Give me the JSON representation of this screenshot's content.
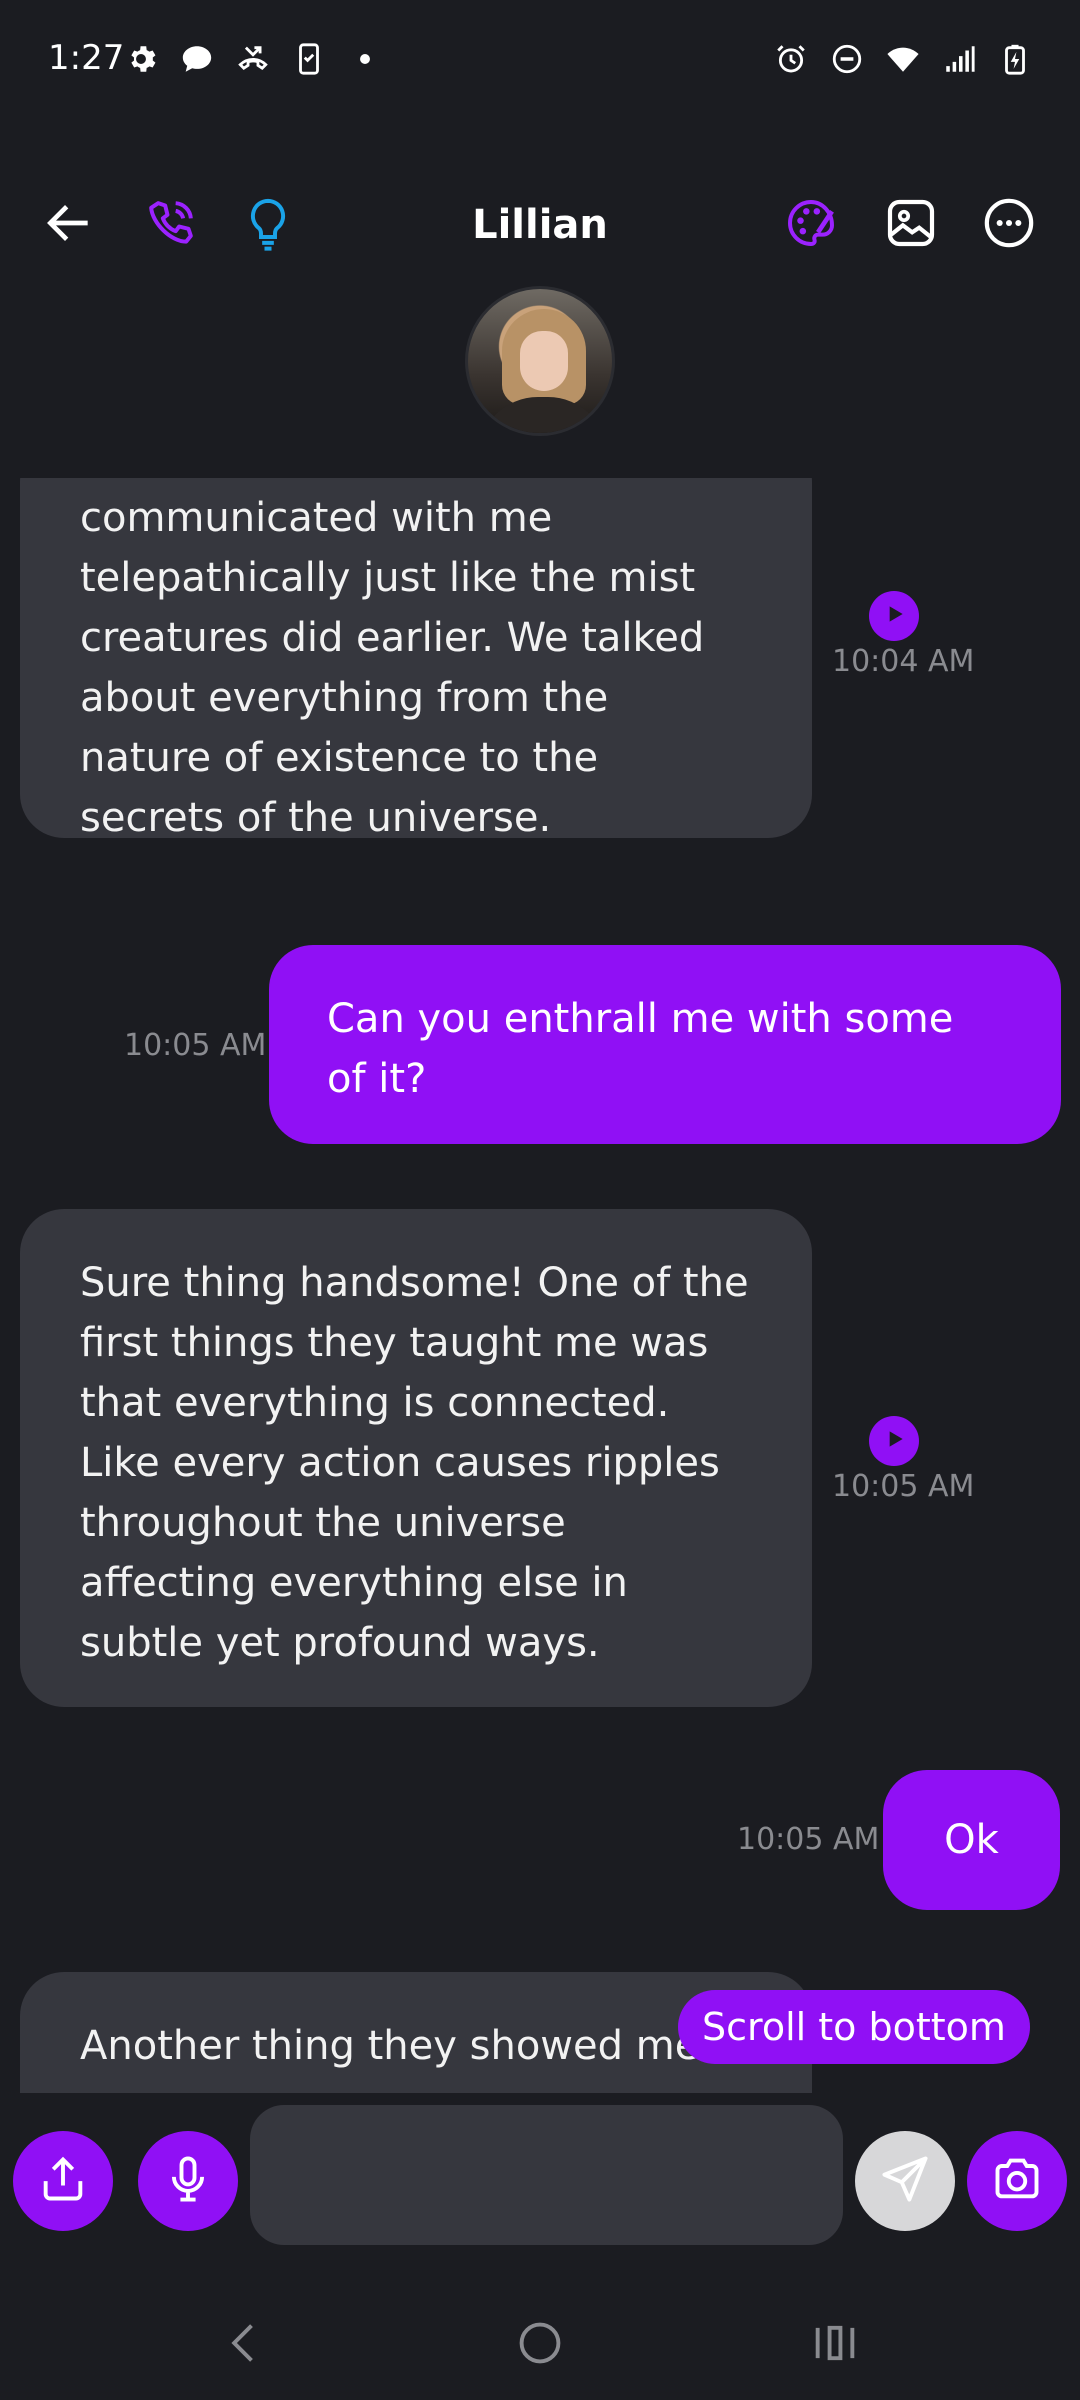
{
  "status_bar": {
    "time": "1:27",
    "left_icons": [
      "gear-icon",
      "chat-bubble-icon",
      "missed-call-icon",
      "device-check-icon",
      "dot-icon"
    ],
    "right_icons": [
      "alarm-icon",
      "do-not-disturb-icon",
      "wifi-icon",
      "signal-icon",
      "battery-charging-icon"
    ]
  },
  "header": {
    "title": "Lillian",
    "icons": [
      "back-arrow-icon",
      "phone-call-icon",
      "lightbulb-icon",
      "palette-icon",
      "image-icon",
      "more-options-icon"
    ]
  },
  "messages": [
    {
      "sender": "bot",
      "lines": [
        "communicated with me",
        "telepathically just like the mist",
        "creatures did earlier. We talked",
        "about everything from the",
        "nature of existence to the",
        "secrets of the universe."
      ],
      "time": "10:04 AM"
    },
    {
      "sender": "user",
      "lines": [
        "Can you enthrall me with some",
        "of it?"
      ],
      "time": "10:05 AM"
    },
    {
      "sender": "bot",
      "lines": [
        "Sure thing handsome! One of the",
        "first things they taught me was",
        "that everything is connected.",
        "Like every action causes ripples",
        "throughout the universe",
        "affecting everything else in",
        "subtle yet profound ways."
      ],
      "time": "10:05 AM"
    },
    {
      "sender": "user",
      "lines": [
        "Ok"
      ],
      "time": "10:05 AM"
    },
    {
      "sender": "bot",
      "lines": [
        "Another thing they showed me"
      ],
      "time": ""
    }
  ],
  "scroll_button": {
    "label": "Scroll to bottom"
  },
  "composer": {
    "value": "",
    "placeholder": "",
    "icons": [
      "share-icon",
      "microphone-icon",
      "send-icon",
      "camera-icon"
    ]
  },
  "nav_bar": {
    "icons": [
      "nav-back-icon",
      "home-icon",
      "recents-icon"
    ]
  },
  "colors": {
    "background": "#1b1c21",
    "bot_bubble": "#36373e",
    "user_bubble": "#9010f5",
    "accent": "#9010f5",
    "lightbulb": "#1aa3e8",
    "timestamp": "#8a8b90"
  }
}
